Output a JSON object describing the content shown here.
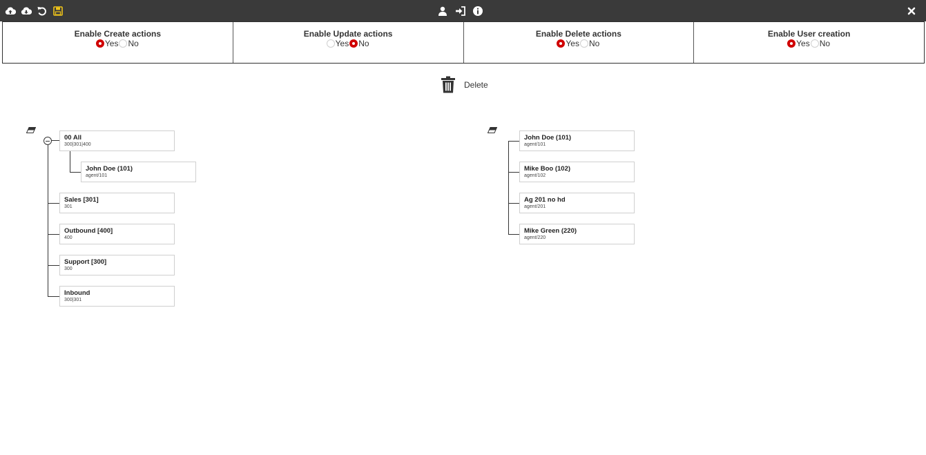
{
  "toolbar": {
    "icons": [
      "cloud-upload-icon",
      "cloud-download-icon",
      "undo-icon",
      "save-icon",
      "user-icon",
      "sign-in-icon",
      "info-icon",
      "close-icon"
    ],
    "accent_color": "#f0c419",
    "background_color": "#3a3a3a"
  },
  "options": [
    {
      "title": "Enable Create actions",
      "yes_label": "Yes",
      "no_label": "No",
      "selected": "Yes"
    },
    {
      "title": "Enable Update actions",
      "yes_label": "Yes",
      "no_label": "No",
      "selected": "No"
    },
    {
      "title": "Enable Delete actions",
      "yes_label": "Yes",
      "no_label": "No",
      "selected": "Yes"
    },
    {
      "title": "Enable User creation",
      "yes_label": "Yes",
      "no_label": "No",
      "selected": "Yes"
    }
  ],
  "radio_selected_color": "#d00000",
  "delete": {
    "label": "Delete"
  },
  "left_tree": {
    "root": {
      "title": "00 All",
      "sub": "300|301|400"
    },
    "root_child": {
      "title": "John Doe (101)",
      "sub": "agent/101"
    },
    "siblings": [
      {
        "title": "Sales [301]",
        "sub": "301"
      },
      {
        "title": "Outbound [400]",
        "sub": "400"
      },
      {
        "title": "Support [300]",
        "sub": "300"
      },
      {
        "title": "Inbound",
        "sub": "300|301"
      }
    ]
  },
  "right_tree": {
    "nodes": [
      {
        "title": "John Doe (101)",
        "sub": "agent/101"
      },
      {
        "title": "Mike Boo (102)",
        "sub": "agent/102"
      },
      {
        "title": "Ag 201 no hd",
        "sub": "agent/201"
      },
      {
        "title": "Mike Green (220)",
        "sub": "agent/220"
      }
    ]
  }
}
